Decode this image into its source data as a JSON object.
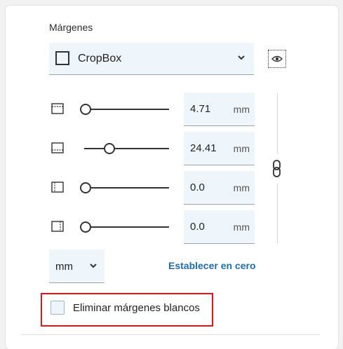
{
  "section_title": "Márgenes",
  "box_select": {
    "value": "CropBox",
    "icon": "chevron-down-icon"
  },
  "preview_toggle": {
    "icon": "eye-icon"
  },
  "margins": [
    {
      "side": "top",
      "value": "4.71",
      "unit": "mm",
      "slider_fraction": 0.0
    },
    {
      "side": "bottom",
      "value": "24.41",
      "unit": "mm",
      "slider_fraction": 0.28
    },
    {
      "side": "left",
      "value": "0.0",
      "unit": "mm",
      "slider_fraction": 0.0
    },
    {
      "side": "right",
      "value": "0.0",
      "unit": "mm",
      "slider_fraction": 0.0
    }
  ],
  "link_toggle": {
    "icon": "link-icon"
  },
  "unit_select": {
    "value": "mm"
  },
  "reset_link": "Establecer en cero",
  "remove_white_margins": {
    "label": "Eliminar márgenes blancos",
    "checked": false
  },
  "colors": {
    "accent": "#1a6fb2",
    "highlight": "#e0161d",
    "field_bg": "#eff6fb"
  }
}
